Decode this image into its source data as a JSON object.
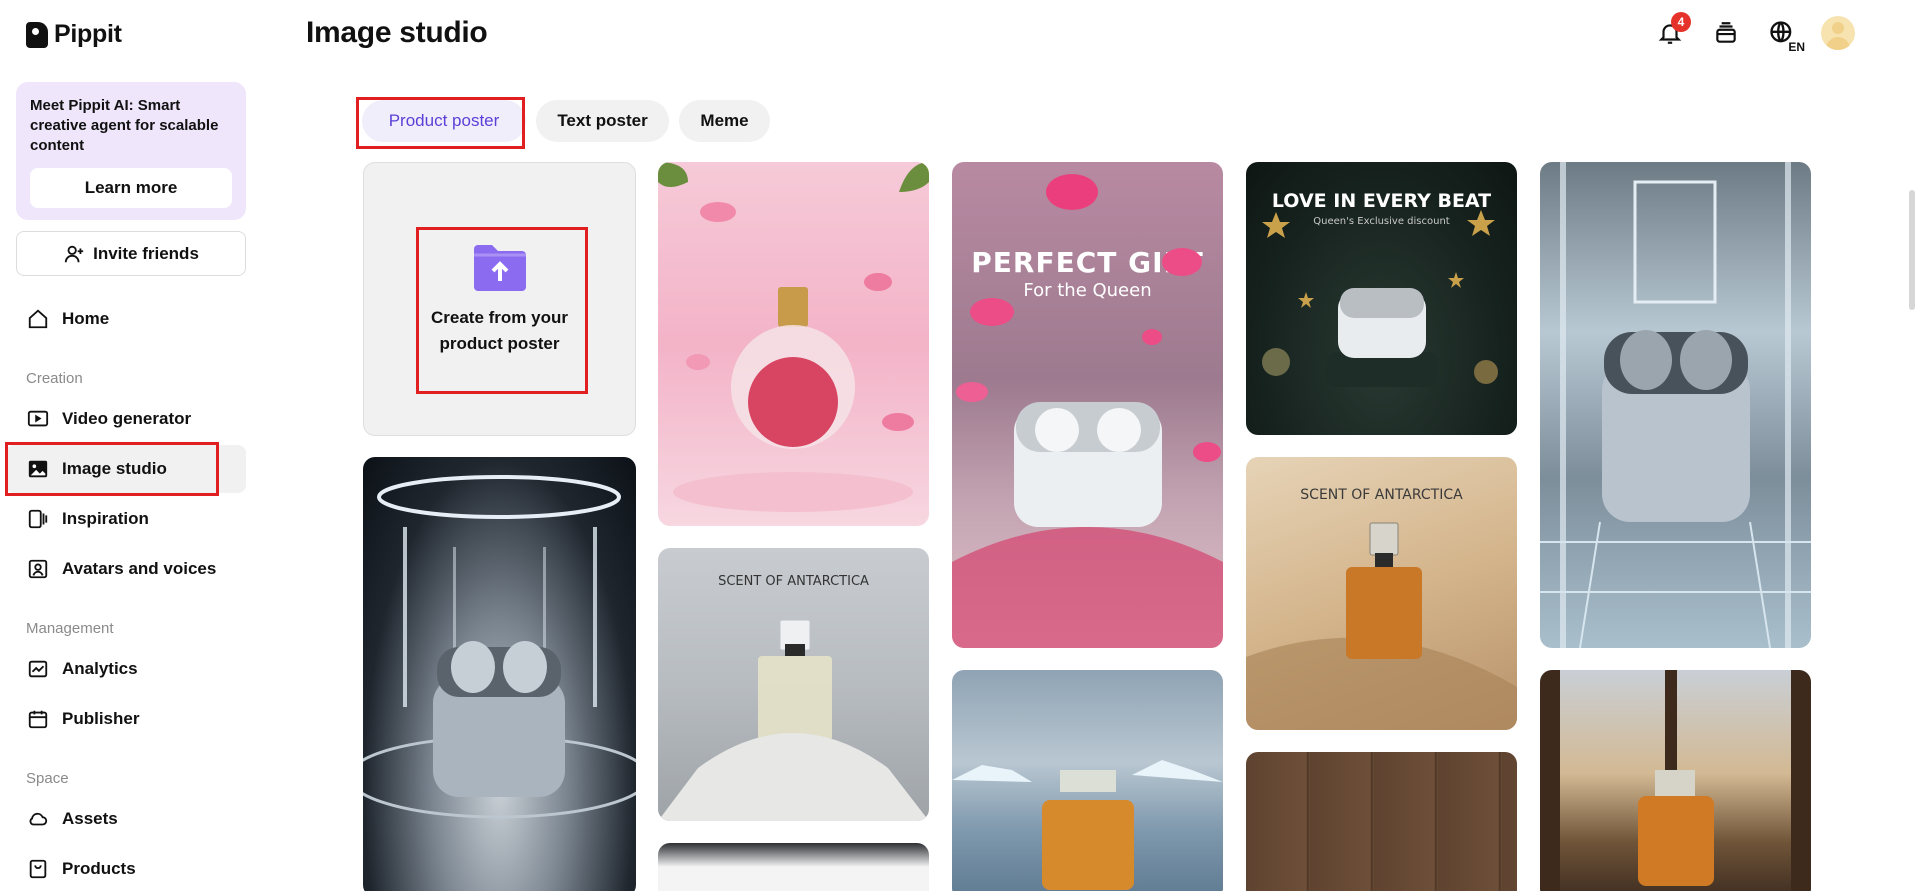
{
  "app": {
    "logo_text": "Pippit"
  },
  "promo": {
    "text": "Meet Pippit AI: Smart creative agent for scalable content",
    "button": "Learn more"
  },
  "invite": {
    "label": "Invite friends"
  },
  "nav": {
    "home": "Home",
    "section_creation": "Creation",
    "video_generator": "Video generator",
    "image_studio": "Image studio",
    "inspiration": "Inspiration",
    "avatars": "Avatars and voices",
    "section_management": "Management",
    "analytics": "Analytics",
    "publisher": "Publisher",
    "section_space": "Space",
    "assets": "Assets",
    "products": "Products"
  },
  "header": {
    "title": "Image studio",
    "notification_count": "4",
    "language": "EN"
  },
  "tabs": [
    "Product poster",
    "Text poster",
    "Meme"
  ],
  "upload_card": {
    "line1": "Create from your",
    "line2": "product poster"
  },
  "posters": {
    "p1_title": "PERFECT GIFT",
    "p1_sub": "For the Queen",
    "p2_title": "LOVE IN EVERY BEAT",
    "p2_sub": "Queen's Exclusive discount",
    "p3_title": "SCENT OF ANTARCTICA",
    "p4_title": "SCENT OF ANTARCTICA"
  },
  "colors": {
    "accent": "#5b3fd6",
    "highlight": "#e02020",
    "promo_bg": "#efe6fb"
  }
}
